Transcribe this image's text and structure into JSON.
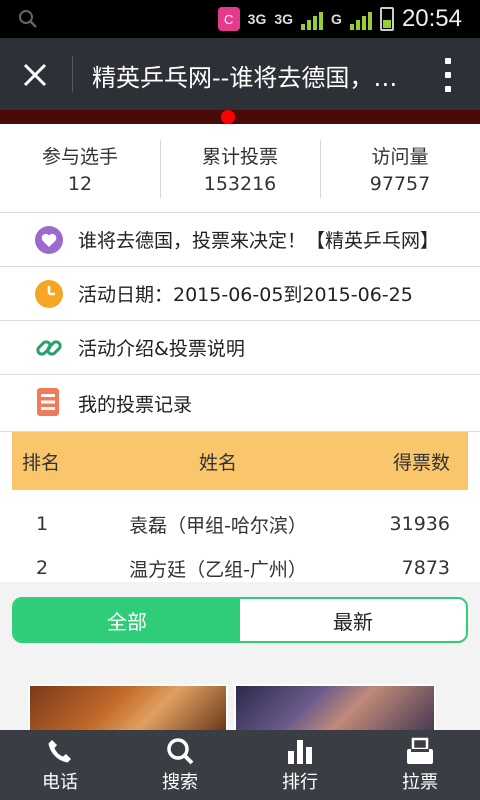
{
  "status_bar": {
    "network_1": "3G",
    "network_2": "3G",
    "network_3": "G",
    "app_badge": "C",
    "time": "20:54"
  },
  "title_bar": {
    "title": "精英乒乓网--谁将去德国，投票来决定！"
  },
  "stats": [
    {
      "label": "参与选手",
      "value": "12"
    },
    {
      "label": "累计投票",
      "value": "153216"
    },
    {
      "label": "访问量",
      "value": "97757"
    }
  ],
  "info": {
    "headline": "谁将去德国，投票来决定！【精英乒乓网】",
    "date": "活动日期：2015-06-05到2015-06-25",
    "intro": "活动介绍&投票说明",
    "records": "我的投票记录"
  },
  "table": {
    "headers": [
      "排名",
      "姓名",
      "得票数"
    ],
    "rows": [
      {
        "rank": "1",
        "name": "袁磊（甲组-哈尔滨）",
        "votes": "31936"
      },
      {
        "rank": "2",
        "name": "温方廷（乙组-广州）",
        "votes": "7873"
      }
    ]
  },
  "tabs": {
    "all": "全部",
    "latest": "最新",
    "active": "all"
  },
  "bottom_nav": [
    {
      "label": "电话",
      "icon": "phone-icon"
    },
    {
      "label": "搜索",
      "icon": "search-icon"
    },
    {
      "label": "排行",
      "icon": "bar-chart-icon"
    },
    {
      "label": "拉票",
      "icon": "ballot-box-icon"
    }
  ],
  "colors": {
    "accent_green": "#2fcd7a",
    "table_header": "#f9c66b",
    "title_bar": "#2d3036",
    "bottom_nav": "#3a3e44",
    "heart": "#9b6bcc",
    "clock": "#f5a623",
    "link": "#2aa06a",
    "list": "#f07a5a"
  }
}
